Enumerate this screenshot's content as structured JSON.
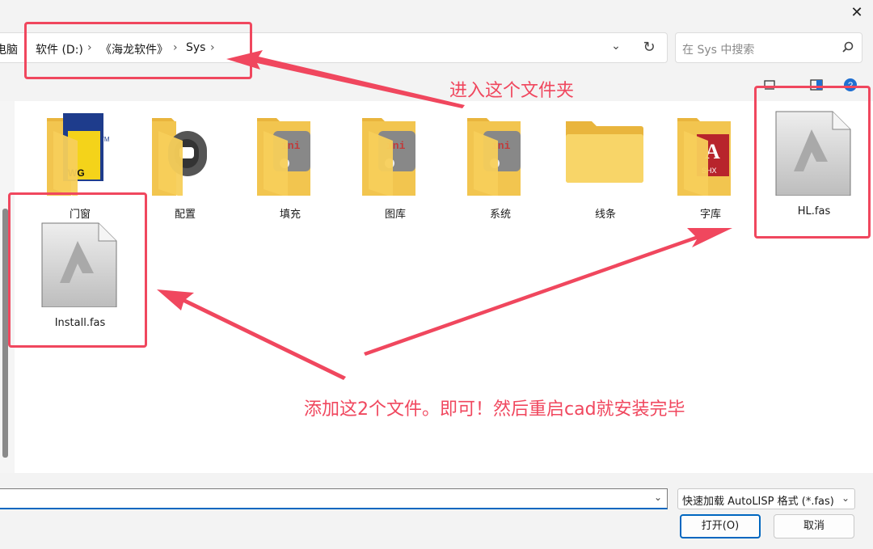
{
  "window": {
    "close_label": "✕"
  },
  "address": {
    "partial_label": "电脑",
    "crumbs": [
      "软件 (D:)",
      "《海龙软件》",
      "Sys"
    ],
    "separator": "›"
  },
  "search": {
    "placeholder": "在 Sys 中搜索"
  },
  "files": [
    {
      "name": "门窗",
      "kind": "folder-dwg"
    },
    {
      "name": "配置",
      "kind": "folder-app"
    },
    {
      "name": "填充",
      "kind": "folder-ini"
    },
    {
      "name": "图库",
      "kind": "folder-ini"
    },
    {
      "name": "系统",
      "kind": "folder-ini"
    },
    {
      "name": "线条",
      "kind": "folder-plain"
    },
    {
      "name": "字库",
      "kind": "folder-shx"
    },
    {
      "name": "HL.fas",
      "kind": "fas-file"
    },
    {
      "name": "Install.fas",
      "kind": "fas-file"
    }
  ],
  "annotations": {
    "enter_folder": "进入这个文件夹",
    "instructions": "添加这2个文件。即可！然后重启cad就安装完毕",
    "color": "#f0475e"
  },
  "thumb_text": {
    "dwg": "WG",
    "tm": "TM",
    "ini": "ini",
    "shx": "SHX",
    "shx_letter": "A"
  },
  "footer": {
    "filename_value": "",
    "filter_value": "快速加载 AutoLISP 格式 (*.fas)",
    "open_label": "打开(O)",
    "cancel_label": "取消"
  }
}
